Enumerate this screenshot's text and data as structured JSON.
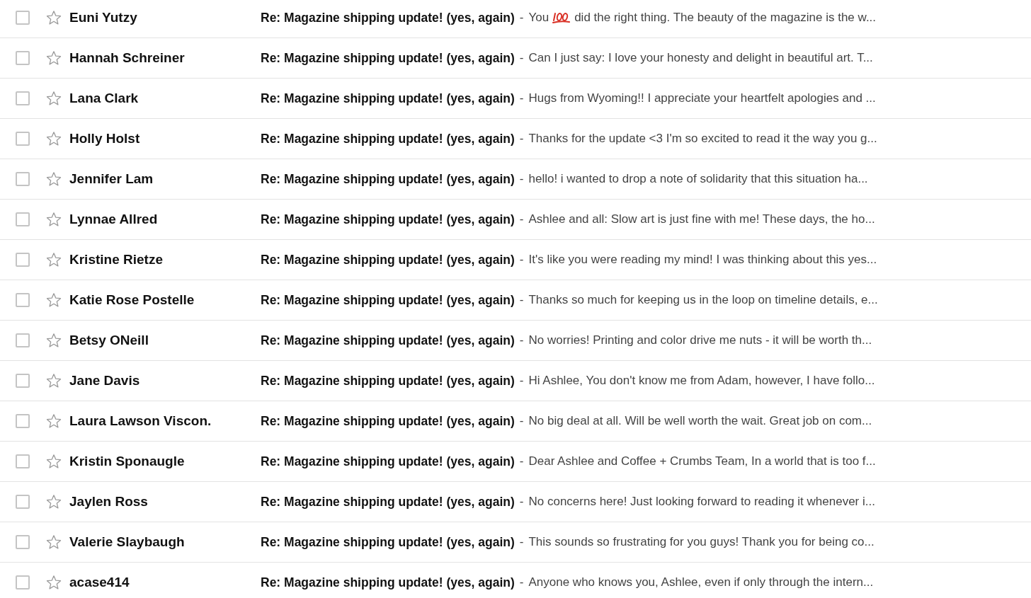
{
  "rows": [
    {
      "sender": "Euni Yutzy",
      "selected": false,
      "starred": false,
      "subject": "Re: Magazine shipping update! (yes, again)",
      "separator": "-",
      "snippet": [
        {
          "kind": "text",
          "text": "You"
        },
        {
          "kind": "hundred-icon"
        },
        {
          "kind": "text",
          "text": "did the right thing. The beauty of the magazine is the w..."
        }
      ]
    },
    {
      "sender": "Hannah Schreiner",
      "selected": false,
      "starred": false,
      "subject": "Re: Magazine shipping update! (yes, again)",
      "separator": "-",
      "snippet": [
        {
          "kind": "text",
          "text": "Can I just say: I love your honesty and delight in beautiful art. T..."
        }
      ]
    },
    {
      "sender": "Lana Clark",
      "selected": false,
      "starred": false,
      "subject": "Re: Magazine shipping update! (yes, again)",
      "separator": "-",
      "snippet": [
        {
          "kind": "text",
          "text": "Hugs from Wyoming!! I appreciate your heartfelt apologies and ..."
        }
      ]
    },
    {
      "sender": "Holly Holst",
      "selected": false,
      "starred": false,
      "subject": "Re: Magazine shipping update! (yes, again)",
      "separator": "-",
      "snippet": [
        {
          "kind": "text",
          "text": "Thanks for the update <3 I'm so excited to read it the way you g..."
        }
      ]
    },
    {
      "sender": "Jennifer Lam",
      "selected": false,
      "starred": false,
      "subject": "Re: Magazine shipping update! (yes, again)",
      "separator": "-",
      "snippet": [
        {
          "kind": "text",
          "text": "hello! i wanted to drop a note of solidarity that this situation ha..."
        }
      ]
    },
    {
      "sender": "Lynnae Allred",
      "selected": false,
      "starred": false,
      "subject": "Re: Magazine shipping update! (yes, again)",
      "separator": "-",
      "snippet": [
        {
          "kind": "text",
          "text": "Ashlee and all: Slow art is just fine with me! These days, the ho..."
        }
      ]
    },
    {
      "sender": "Kristine Rietze",
      "selected": false,
      "starred": false,
      "subject": "Re: Magazine shipping update! (yes, again)",
      "separator": "-",
      "snippet": [
        {
          "kind": "text",
          "text": "It's like you were reading my mind! I was thinking about this yes..."
        }
      ]
    },
    {
      "sender": "Katie Rose Postelle",
      "selected": false,
      "starred": false,
      "subject": "Re: Magazine shipping update! (yes, again)",
      "separator": "-",
      "snippet": [
        {
          "kind": "text",
          "text": "Thanks so much for keeping us in the loop on timeline details, e..."
        }
      ]
    },
    {
      "sender": "Betsy ONeill",
      "selected": false,
      "starred": false,
      "subject": "Re: Magazine shipping update! (yes, again)",
      "separator": "-",
      "snippet": [
        {
          "kind": "text",
          "text": "No worries! Printing and color drive me nuts - it will be worth th..."
        }
      ]
    },
    {
      "sender": "Jane Davis",
      "selected": false,
      "starred": false,
      "subject": "Re: Magazine shipping update! (yes, again)",
      "separator": "-",
      "snippet": [
        {
          "kind": "text",
          "text": "Hi Ashlee, You don't know me from Adam, however, I have follo..."
        }
      ]
    },
    {
      "sender": "Laura Lawson Viscon.",
      "selected": false,
      "starred": false,
      "subject": "Re: Magazine shipping update! (yes, again)",
      "separator": "-",
      "snippet": [
        {
          "kind": "text",
          "text": "No big deal at all. Will be well worth the wait. Great job on com..."
        }
      ]
    },
    {
      "sender": "Kristin Sponaugle",
      "selected": false,
      "starred": false,
      "subject": "Re: Magazine shipping update! (yes, again)",
      "separator": "-",
      "snippet": [
        {
          "kind": "text",
          "text": "Dear Ashlee and Coffee + Crumbs Team, In a world that is too f..."
        }
      ]
    },
    {
      "sender": "Jaylen Ross",
      "selected": false,
      "starred": false,
      "subject": "Re: Magazine shipping update! (yes, again)",
      "separator": "-",
      "snippet": [
        {
          "kind": "text",
          "text": "No concerns here! Just looking forward to reading it whenever i..."
        }
      ]
    },
    {
      "sender": "Valerie Slaybaugh",
      "selected": false,
      "starred": false,
      "subject": "Re: Magazine shipping update! (yes, again)",
      "separator": "-",
      "snippet": [
        {
          "kind": "text",
          "text": "This sounds so frustrating for you guys! Thank you for being co..."
        }
      ]
    },
    {
      "sender": "acase414",
      "selected": false,
      "starred": false,
      "subject": "Re: Magazine shipping update! (yes, again)",
      "separator": "-",
      "snippet": [
        {
          "kind": "text",
          "text": "Anyone who knows you, Ashlee, even if only through the intern..."
        }
      ]
    }
  ]
}
